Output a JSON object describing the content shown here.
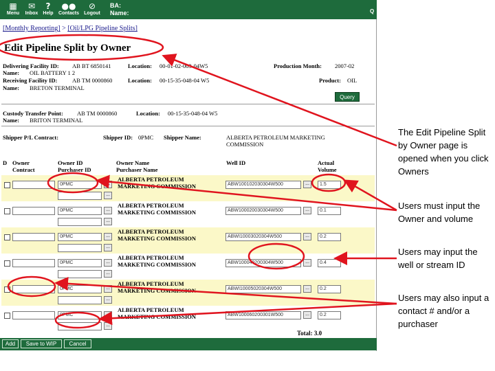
{
  "nav": {
    "menu": "Menu",
    "inbox": "Inbox",
    "help": "Help",
    "contacts": "Contacts",
    "logout": "Logout",
    "ba": "BA:",
    "name": "Name:",
    "corner": "Q"
  },
  "breadcrumb": {
    "link": "[Monthly Reporting]",
    "sep": " > ",
    "current": "[Oil/LPG Pipeline Splits]"
  },
  "page_title": "Edit Pipeline Split by Owner",
  "header": {
    "delivering_label": "Delivering Facility ID:",
    "delivering_id": "AB BT 6850141",
    "location_label": "Location:",
    "delivering_location": "00-01-02-003-04W5",
    "production_month_label": "Production Month:",
    "production_month": "2007-02",
    "name_label": "Name:",
    "delivering_name": "OIL BATTERY 1 2",
    "receiving_label": "Receiving Facility ID:",
    "receiving_id": "AB TM 0000860",
    "receiving_location": "00-15-35-048-04 W5",
    "product_label": "Product:",
    "product": "OIL",
    "receiving_name": "BRETON TERMINAL",
    "query_button": "Query",
    "custody_label": "Custody Transfer Point:",
    "custody_id": "AB TM 0000860",
    "custody_location": "00-15-35-048-04 W5",
    "custody_name": "BRITON TERMINAL"
  },
  "shipper": {
    "pl_contract_label": "Shipper P/L Contract:",
    "id_label": "Shipper ID:",
    "id": "0PMC",
    "name_label": "Shipper Name:",
    "name_line1": "ALBERTA PETROLEUM MARKETING",
    "name_line2": "COMMISSION"
  },
  "columns": {
    "d": "D",
    "owner_contract_1": "Owner",
    "owner_contract_2": "Contract",
    "owner_id_1": "Owner ID",
    "owner_id_2": "Purchaser ID",
    "owner_name_1": "Owner Name",
    "owner_name_2": "Purchaser Name",
    "well_id": "Well ID",
    "volume_1": "Actual",
    "volume_2": "Volume"
  },
  "rows": [
    {
      "owner_id": "0PMC",
      "name_1": "ALBERTA PETROLEUM",
      "name_2": "MARKETING COMMISSION",
      "well_id": "ABW100102030304W500",
      "volume": "1.5"
    },
    {
      "owner_id": "0PMC",
      "name_1": "ALBERTA PETROLEUM",
      "name_2": "MARKETING COMMISSION",
      "well_id": "ABW100020030304W500",
      "volume": "0.1"
    },
    {
      "owner_id": "0PMC",
      "name_1": "ALBERTA PETROLEUM",
      "name_2": "MARKETING COMMISSION",
      "well_id": "ABWI10003020304W500",
      "volume": "0.2"
    },
    {
      "owner_id": "0PMC",
      "name_1": "ALBERTA PETROLEUM",
      "name_2": "MARKETING COMMISSION",
      "well_id": "ABW100040200304W500",
      "volume": "0.4"
    },
    {
      "owner_id": "0PMC",
      "name_1": "ALBERTA PETROLEUM",
      "name_2": "MARKETING COMMISSION",
      "well_id": "ABWI10005020304W500",
      "volume": "0.2"
    },
    {
      "owner_id": "0PMC",
      "name_1": "ALBERTA PETROLEUM",
      "name_2": "MARKETING COMMISSION",
      "well_id": "ABW100060200301W500",
      "volume": "0.2"
    }
  ],
  "dots_label": "...",
  "total": "Total: 3.0",
  "buttons": {
    "add": "Add",
    "save": "Save to WIP",
    "cancel": "Cancel"
  },
  "annotations": {
    "note_1": "The Edit Pipeline Split by Owner page is opened when you click Owners",
    "note_2": "Users must input the Owner and volume",
    "note_3": "Users may input the well or stream ID",
    "note_4": "Users may also input a contact # and/or a purchaser",
    "arrow_color": "#e0141e"
  },
  "colors": {
    "nav_green": "#1e6b3c",
    "row_highlight": "#fbf8c8",
    "link_blue": "#1a1a8c"
  }
}
